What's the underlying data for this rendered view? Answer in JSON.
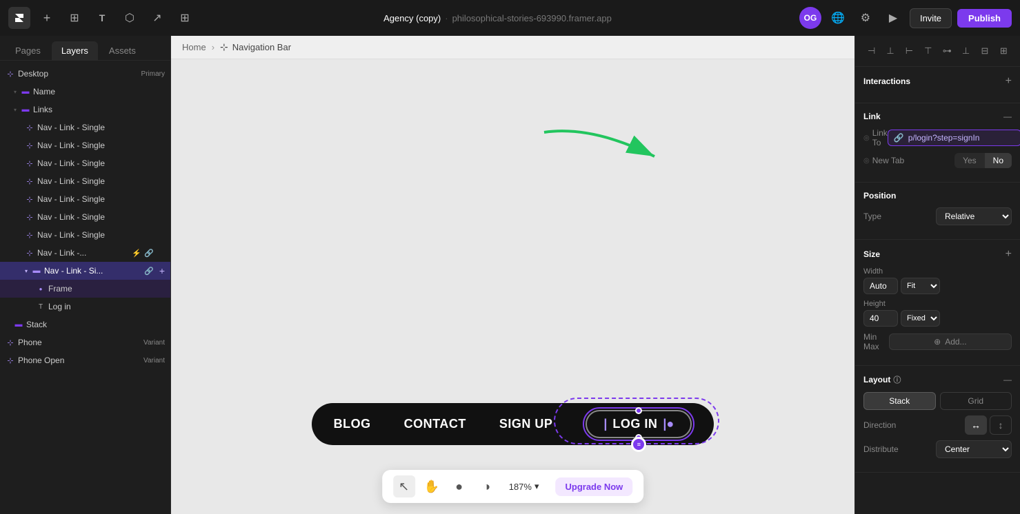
{
  "app": {
    "name": "Agency (copy)",
    "url": "philosophical-stories-693990.framer.app",
    "avatar_initials": "OG"
  },
  "toolbar": {
    "invite_label": "Invite",
    "publish_label": "Publish"
  },
  "breadcrumb": {
    "home": "Home",
    "active": "Navigation Bar"
  },
  "left_panel": {
    "tabs": [
      "Pages",
      "Layers",
      "Assets"
    ],
    "active_tab": "Layers",
    "layers": [
      {
        "id": "desktop",
        "label": "Desktop",
        "badge": "Primary",
        "indent": 0,
        "type": "component",
        "expanded": true
      },
      {
        "id": "name",
        "label": "Name",
        "indent": 1,
        "type": "frame"
      },
      {
        "id": "links",
        "label": "Links",
        "indent": 1,
        "type": "frame",
        "expanded": true
      },
      {
        "id": "nav-link-1",
        "label": "Nav - Link - Single",
        "indent": 2,
        "type": "component"
      },
      {
        "id": "nav-link-2",
        "label": "Nav - Link - Single",
        "indent": 2,
        "type": "component"
      },
      {
        "id": "nav-link-3",
        "label": "Nav - Link - Single",
        "indent": 2,
        "type": "component"
      },
      {
        "id": "nav-link-4",
        "label": "Nav - Link - Single",
        "indent": 2,
        "type": "component"
      },
      {
        "id": "nav-link-5",
        "label": "Nav - Link - Single",
        "indent": 2,
        "type": "component"
      },
      {
        "id": "nav-link-6",
        "label": "Nav - Link - Single",
        "indent": 2,
        "type": "component"
      },
      {
        "id": "nav-link-7",
        "label": "Nav - Link - Single",
        "indent": 2,
        "type": "component"
      },
      {
        "id": "nav-link-truncated",
        "label": "Nav - Link -...",
        "indent": 2,
        "type": "component",
        "has_link": true,
        "has_lock": true
      },
      {
        "id": "nav-link-selected",
        "label": "Nav - Link - Si...",
        "indent": 2,
        "type": "component",
        "selected": true,
        "has_link": true
      },
      {
        "id": "frame",
        "label": "Frame",
        "indent": 3,
        "type": "dot"
      },
      {
        "id": "log-in",
        "label": "Log in",
        "indent": 3,
        "type": "text"
      },
      {
        "id": "stack",
        "label": "Stack",
        "indent": 1,
        "type": "frame"
      },
      {
        "id": "phone",
        "label": "Phone",
        "badge": "Variant",
        "indent": 0,
        "type": "component"
      },
      {
        "id": "phone-open",
        "label": "Phone Open",
        "badge": "Variant",
        "indent": 0,
        "type": "component"
      }
    ]
  },
  "canvas": {
    "nav_items": [
      "BLOG",
      "CONTACT",
      "SIGN UP"
    ],
    "login_label": "LOG IN"
  },
  "bottom_bar": {
    "zoom_level": "187%",
    "upgrade_label": "Upgrade Now"
  },
  "right_panel": {
    "interactions_title": "Interactions",
    "link_title": "Link",
    "link_to_label": "Link To",
    "link_to_value": "p/login?step=signIn",
    "new_tab_label": "New Tab",
    "new_tab_yes": "Yes",
    "new_tab_no": "No",
    "position_title": "Position",
    "position_type_label": "Type",
    "position_type_value": "Relative",
    "size_title": "Size",
    "width_label": "Width",
    "width_value": "Auto",
    "width_type": "Fit",
    "height_label": "Height",
    "height_value": "40",
    "height_type": "Fixed",
    "min_max_label": "Min Max",
    "min_max_placeholder": "Add...",
    "layout_title": "Layout",
    "layout_type_stack": "Stack",
    "layout_type_grid": "Grid",
    "direction_label": "Direction",
    "distribute_label": "Distribute",
    "distribute_value": "Center"
  }
}
